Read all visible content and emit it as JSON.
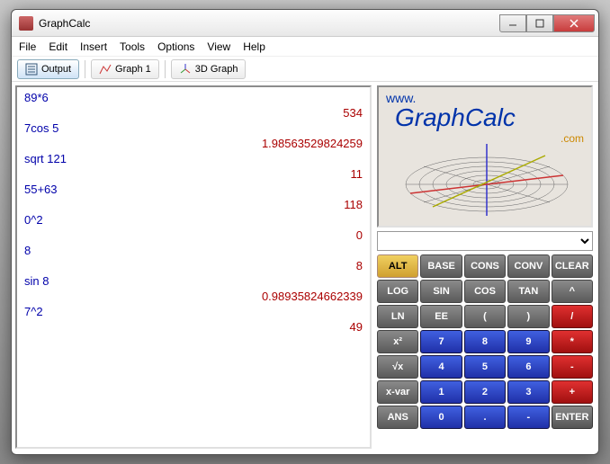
{
  "title": "GraphCalc",
  "menu": [
    "File",
    "Edit",
    "Insert",
    "Tools",
    "Options",
    "View",
    "Help"
  ],
  "tabs": [
    {
      "label": "Output",
      "active": true
    },
    {
      "label": "Graph 1",
      "active": false
    },
    {
      "label": "3D Graph",
      "active": false
    }
  ],
  "output": [
    {
      "expr": "89*6",
      "result": "534"
    },
    {
      "expr": "7cos 5",
      "result": "1.98563529824259"
    },
    {
      "expr": "sqrt 121",
      "result": "11"
    },
    {
      "expr": "55+63",
      "result": "118"
    },
    {
      "expr": "0^2",
      "result": "0"
    },
    {
      "expr": "8",
      "result": "8"
    },
    {
      "expr": "sin 8",
      "result": "0.98935824662339"
    },
    {
      "expr": "7^2",
      "result": "49"
    }
  ],
  "logo": {
    "www": "www.",
    "name": "GraphCalc",
    "dot": ".com"
  },
  "keys": [
    {
      "label": "ALT",
      "cls": "k-yellow"
    },
    {
      "label": "BASE",
      "cls": "k-gray"
    },
    {
      "label": "CONS",
      "cls": "k-gray"
    },
    {
      "label": "CONV",
      "cls": "k-gray"
    },
    {
      "label": "CLEAR",
      "cls": "k-gray"
    },
    {
      "label": "LOG",
      "cls": "k-gray"
    },
    {
      "label": "SIN",
      "cls": "k-gray"
    },
    {
      "label": "COS",
      "cls": "k-gray"
    },
    {
      "label": "TAN",
      "cls": "k-gray"
    },
    {
      "label": "^",
      "cls": "k-gray"
    },
    {
      "label": "LN",
      "cls": "k-gray"
    },
    {
      "label": "EE",
      "cls": "k-gray"
    },
    {
      "label": "(",
      "cls": "k-gray"
    },
    {
      "label": ")",
      "cls": "k-gray"
    },
    {
      "label": "/",
      "cls": "k-red"
    },
    {
      "label": "x²",
      "cls": "k-gray"
    },
    {
      "label": "7",
      "cls": "k-blue"
    },
    {
      "label": "8",
      "cls": "k-blue"
    },
    {
      "label": "9",
      "cls": "k-blue"
    },
    {
      "label": "*",
      "cls": "k-red"
    },
    {
      "label": "√x",
      "cls": "k-gray"
    },
    {
      "label": "4",
      "cls": "k-blue"
    },
    {
      "label": "5",
      "cls": "k-blue"
    },
    {
      "label": "6",
      "cls": "k-blue"
    },
    {
      "label": "-",
      "cls": "k-red"
    },
    {
      "label": "x-var",
      "cls": "k-gray"
    },
    {
      "label": "1",
      "cls": "k-blue"
    },
    {
      "label": "2",
      "cls": "k-blue"
    },
    {
      "label": "3",
      "cls": "k-blue"
    },
    {
      "label": "+",
      "cls": "k-red"
    },
    {
      "label": "ANS",
      "cls": "k-gray"
    },
    {
      "label": "0",
      "cls": "k-blue"
    },
    {
      "label": ".",
      "cls": "k-blue"
    },
    {
      "label": "-",
      "cls": "k-blue"
    },
    {
      "label": "ENTER",
      "cls": "k-enter"
    }
  ]
}
